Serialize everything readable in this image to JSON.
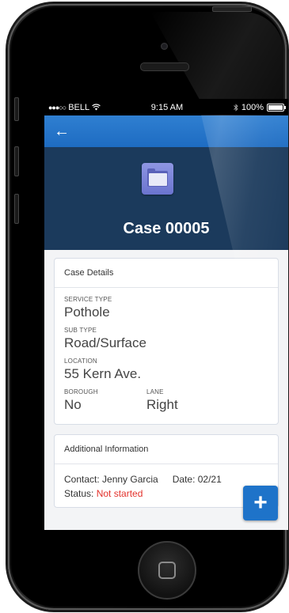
{
  "statusbar": {
    "carrier": "BELL",
    "signal_dots": "●●●○○",
    "time": "9:15 AM",
    "battery": "100%",
    "battery_level": 1.0
  },
  "header": {
    "title": "Case 00005",
    "accent_color": "#1e6cc2",
    "header_color": "#1b3a5c"
  },
  "case_details": {
    "title": "Case Details",
    "service_type_label": "SERVICE TYPE",
    "service_type_value": "Pothole",
    "sub_type_label": "SUB TYPE",
    "sub_type_value": "Road/Surface",
    "location_label": "LOCATION",
    "location_value": "55 Kern Ave.",
    "borough_label": "BOROUGH",
    "borough_value": "No",
    "lane_label": "LANE",
    "lane_value": "Right"
  },
  "additional_info": {
    "title": "Additional Information",
    "contact": "Contact: Jenny Garcia",
    "date": "Date: 02/21",
    "status_label": "Status:",
    "status_value": "Not started",
    "status_color": "#e3312b"
  },
  "fab": {
    "label": "+"
  },
  "icons": [
    "back-arrow-icon",
    "wifi-icon",
    "bluetooth-icon",
    "battery-icon",
    "folder-icon",
    "plus-icon"
  ]
}
